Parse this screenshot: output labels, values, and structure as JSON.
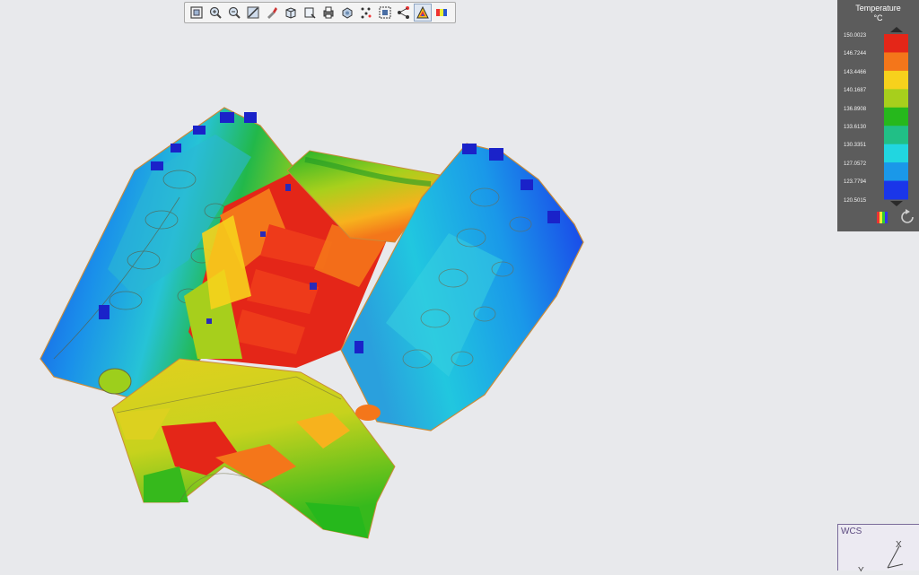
{
  "toolbar": {
    "tools": [
      {
        "name": "zoom-fit-icon"
      },
      {
        "name": "zoom-in-icon"
      },
      {
        "name": "zoom-out-icon"
      },
      {
        "name": "zoom-area-icon"
      },
      {
        "name": "pan-icon"
      },
      {
        "name": "view-cube-icon"
      },
      {
        "name": "view-orientation-icon"
      },
      {
        "name": "print-icon"
      },
      {
        "name": "render-style-icon"
      },
      {
        "name": "section-icon"
      },
      {
        "name": "select-icon"
      },
      {
        "name": "network-icon"
      },
      {
        "name": "contour-plot-icon"
      },
      {
        "name": "legend-icon"
      }
    ],
    "active_tool": "contour-plot-icon"
  },
  "legend": {
    "title": "Temperature",
    "unit": "°C",
    "values": [
      "150.0023",
      "146.7244",
      "143.4466",
      "140.1687",
      "136.8908",
      "133.6130",
      "130.3351",
      "127.0572",
      "123.7794",
      "120.5015"
    ],
    "colors": [
      "#e42618",
      "#f4761a",
      "#f7d11c",
      "#a7cf1c",
      "#26b81c",
      "#21bf86",
      "#21d6e0",
      "#1a98e9",
      "#1a36e9"
    ]
  },
  "wcs": {
    "label": "WCS",
    "x_axis": "X",
    "y_axis": "Y"
  },
  "accent_colors": {
    "background": "#e8e9ec",
    "legend_panel": "#5c5c5c"
  }
}
